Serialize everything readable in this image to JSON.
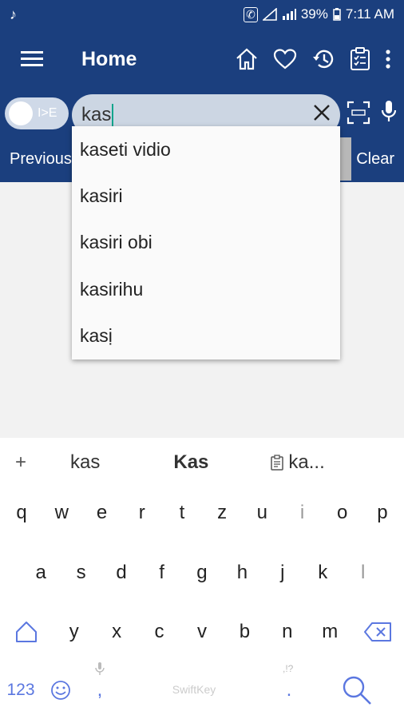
{
  "status": {
    "time": "7:11 AM",
    "battery": "39%"
  },
  "appbar": {
    "title": "Home"
  },
  "search": {
    "toggle_label": "I>E",
    "value": "kas"
  },
  "nav": {
    "previous": "Previous",
    "clear": "Clear"
  },
  "dropdown": {
    "items": [
      "kaseti vidio",
      "kasiri",
      "kasiri obi",
      "kasirihu",
      "kasị"
    ]
  },
  "keyboard": {
    "suggestions": [
      "kas",
      "Kas",
      "ka..."
    ],
    "row1": [
      "q",
      "w",
      "e",
      "r",
      "t",
      "z",
      "u",
      "i",
      "o",
      "p"
    ],
    "row2": [
      "a",
      "s",
      "d",
      "f",
      "g",
      "h",
      "j",
      "k",
      "l"
    ],
    "row3": [
      "y",
      "x",
      "c",
      "v",
      "b",
      "n",
      "m"
    ],
    "numbers_key": "123",
    "space_brand": "SwiftKey",
    "comma": ",",
    "period": ".",
    "punct_hint": ",!?"
  },
  "colors": {
    "primary": "#1b3f7e",
    "cursor": "#12a58c",
    "keyboard_accent": "#5b77e0"
  }
}
